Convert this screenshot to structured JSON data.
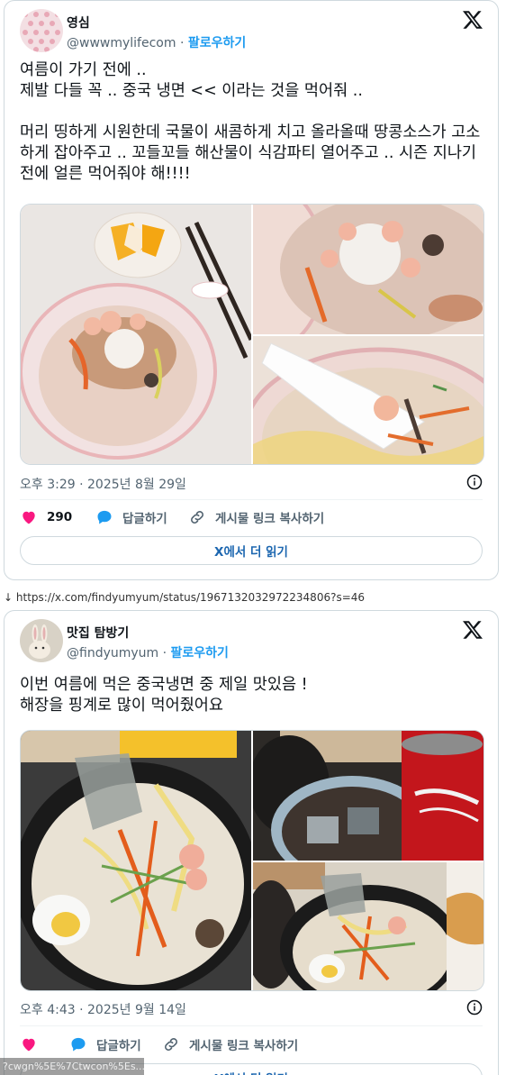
{
  "tweets": [
    {
      "display_name": "영심",
      "handle": "@wwwmylifecom",
      "separator": "·",
      "follow_label": "팔로우하기",
      "text": "여름이 가기 전에 ..\n제발 다들 꼭 .. 중국 냉면 << 이라는 것을 먹어줘 ..\n\n머리 띵하게 시원한데 국물이 새콤하게 치고 올라올때 땅콩소스가 고소하게 잡아주고 .. 꼬들꼬들 해산물이 식감파티 열어주고 .. 시즌 지나기 전에 얼른 먹어줘야 해!!!!",
      "timestamp": "오후 3:29 · 2025년 8월 29일",
      "like_count": "290",
      "reply_label": "답글하기",
      "copy_link_label": "게시물 링크 복사하기",
      "read_more_label": "X에서 더 읽기",
      "icons": [
        "x-logo-icon",
        "info-icon",
        "heart-icon",
        "reply-bubble-icon",
        "link-icon"
      ]
    },
    {
      "display_name": "맛집 탐방기",
      "handle": "@findyumyum",
      "separator": "·",
      "follow_label": "팔로우하기",
      "text": "이번 여름에 먹은 중국냉면 중 제일 맛있음 !\n해장을 핑계로 많이 먹어줬어요",
      "timestamp": "오후 4:43 · 2025년 9월 14일",
      "reply_label": "답글하기",
      "copy_link_label": "게시물 링크 복사하기",
      "read_more_label": "X에서 더 읽기"
    }
  ],
  "source_link": {
    "arrow": "↓",
    "url": "https://x.com/findyumyum/status/1967132032972234806?s=46"
  },
  "overlay_text": "?cwgn%5E%7Ctwcon%5Es...",
  "colors": {
    "accent_blue": "#1d9bf0",
    "like_red": "#f91880",
    "muted_text": "#536471",
    "border": "#cfd9de"
  }
}
